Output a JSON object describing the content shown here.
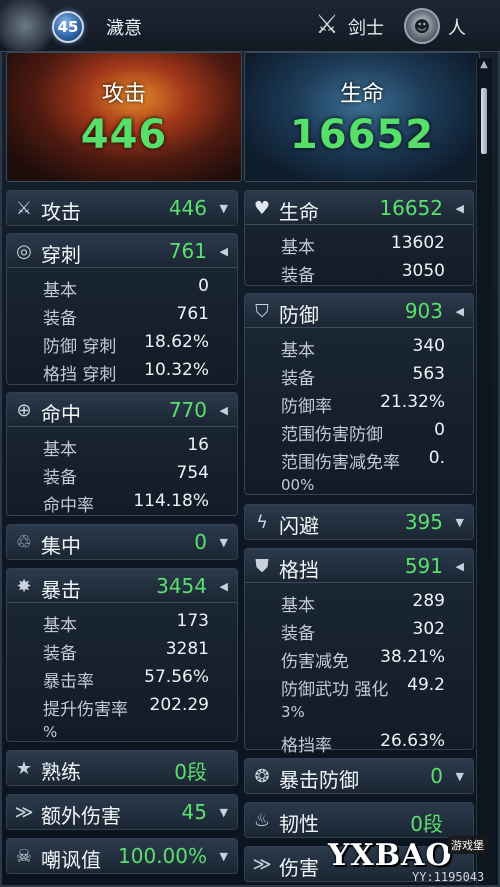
{
  "header": {
    "level": "45",
    "character_name": "濊意",
    "class_label": "剑士",
    "race_label": "人",
    "icons": {
      "dragon": "dragon-emblem-icon",
      "class": "crossed-swords-icon",
      "race": "human-portrait-icon"
    }
  },
  "hero": {
    "attack": {
      "title": "攻击",
      "value": "446"
    },
    "health": {
      "title": "生命",
      "value": "16652"
    }
  },
  "left_column": {
    "attack": {
      "label": "攻击",
      "value": "446",
      "icon": "crossed-swords-icon"
    },
    "pierce": {
      "label": "穿刺",
      "value": "761",
      "icon": "pierce-icon",
      "rows": [
        {
          "label": "基本",
          "value": "0"
        },
        {
          "label": "装备",
          "value": "761"
        },
        {
          "label": "防御 穿刺",
          "value": "18.62%"
        },
        {
          "label": "格挡 穿刺",
          "value": "10.32%"
        }
      ]
    },
    "accuracy": {
      "label": "命中",
      "value": "770",
      "icon": "crosshair-icon",
      "rows": [
        {
          "label": "基本",
          "value": "16"
        },
        {
          "label": "装备",
          "value": "754"
        },
        {
          "label": "命中率",
          "value": "114.18%"
        }
      ]
    },
    "concentration": {
      "label": "集中",
      "value": "0",
      "icon": "concentration-icon"
    },
    "critical": {
      "label": "暴击",
      "value": "3454",
      "icon": "burst-icon",
      "rows": [
        {
          "label": "基本",
          "value": "173"
        },
        {
          "label": "装备",
          "value": "3281"
        },
        {
          "label": "暴击率",
          "value": "57.56%"
        },
        {
          "label": "提升伤害率",
          "value": "202.29"
        },
        {
          "label": "%",
          "value": ""
        }
      ]
    },
    "mastery": {
      "label": "熟练",
      "value": "0段",
      "icon": "star-icon"
    },
    "extra_damage": {
      "label": "额外伤害",
      "value": "45",
      "icon": "slash-icon"
    },
    "threat": {
      "label": "嘲讽值",
      "value": "100.00%",
      "icon": "skull-icon"
    }
  },
  "right_column": {
    "health": {
      "label": "生命",
      "value": "16652",
      "icon": "heart-icon",
      "rows": [
        {
          "label": "基本",
          "value": "13602"
        },
        {
          "label": "装备",
          "value": "3050"
        }
      ]
    },
    "defense": {
      "label": "防御",
      "value": "903",
      "icon": "shield-icon",
      "rows": [
        {
          "label": "基本",
          "value": "340"
        },
        {
          "label": "装备",
          "value": "563"
        },
        {
          "label": "防御率",
          "value": "21.32%"
        },
        {
          "label": "范围伤害防御",
          "value": "0"
        },
        {
          "label": "范围伤害减免率",
          "value": "0."
        },
        {
          "label": "00%",
          "value": ""
        }
      ]
    },
    "evasion": {
      "label": "闪避",
      "value": "395",
      "icon": "lightning-icon"
    },
    "block": {
      "label": "格挡",
      "value": "591",
      "icon": "block-shield-icon",
      "rows": [
        {
          "label": "基本",
          "value": "289"
        },
        {
          "label": "装备",
          "value": "302"
        },
        {
          "label": "伤害减免",
          "value": "38.21%"
        },
        {
          "label": "防御武功 强化",
          "value": "49.2"
        },
        {
          "label": "3%",
          "value": ""
        },
        {
          "label": "格挡率",
          "value": "26.63%"
        }
      ]
    },
    "crit_defense": {
      "label": "暴击防御",
      "value": "0",
      "icon": "crit-defense-icon"
    },
    "toughness": {
      "label": "韧性",
      "value": "0段",
      "icon": "toughness-icon"
    },
    "damage_reduction": {
      "label": "伤害",
      "value": "",
      "icon": "damage-reduction-icon"
    }
  },
  "watermark": {
    "text": "YXBAO",
    "sub": "游戏堡",
    "id": "YY:1195043"
  }
}
